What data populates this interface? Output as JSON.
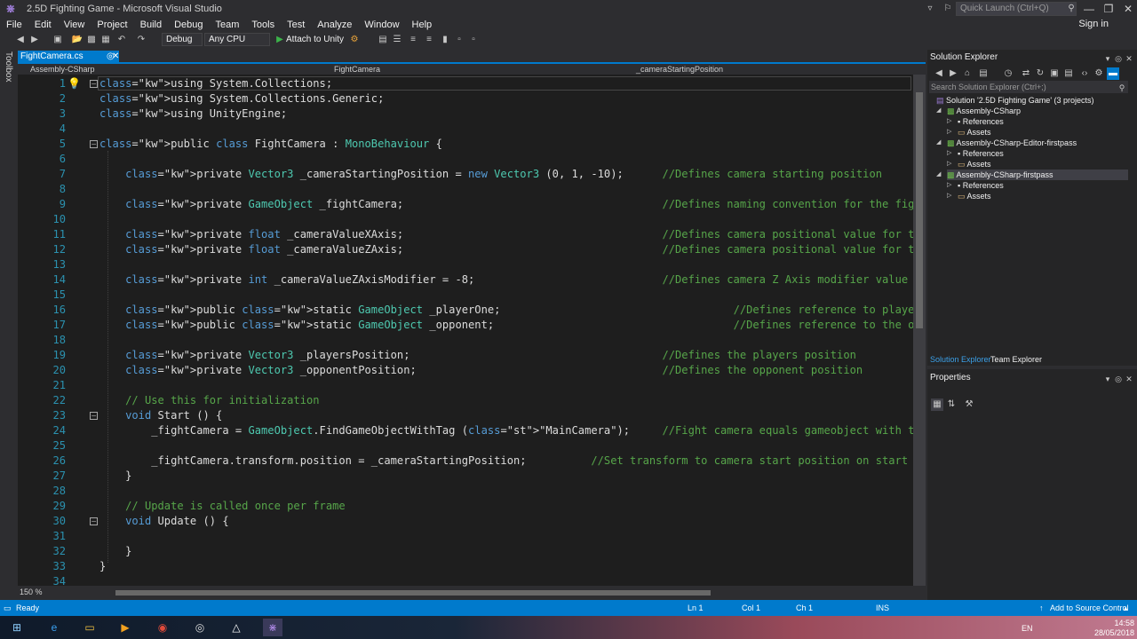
{
  "window": {
    "title": "2.5D Fighting Game - Microsoft Visual Studio",
    "quick_launch_placeholder": "Quick Launch (Ctrl+Q)",
    "sign_in": "Sign in",
    "minimize": "—",
    "restore": "❐",
    "close": "✕"
  },
  "menu": [
    "File",
    "Edit",
    "View",
    "Project",
    "Build",
    "Debug",
    "Team",
    "Tools",
    "Test",
    "Analyze",
    "Window",
    "Help"
  ],
  "toolbar": {
    "config": "Debug",
    "platform": "Any CPU",
    "attach": "Attach to Unity"
  },
  "toolbox_label": "Toolbox",
  "editor": {
    "tab": "FightCamera.cs",
    "nav_project": "Assembly-CSharp",
    "nav_class": "FightCamera",
    "nav_member": "_cameraStartingPosition",
    "zoom": "150 %",
    "lines": [
      {
        "n": "1",
        "t": "using System.Collections;"
      },
      {
        "n": "2",
        "t": "using System.Collections.Generic;"
      },
      {
        "n": "3",
        "t": "using UnityEngine;"
      },
      {
        "n": "4",
        "t": ""
      },
      {
        "n": "5",
        "t": "public class FightCamera : MonoBehaviour {"
      },
      {
        "n": "6",
        "t": ""
      },
      {
        "n": "7",
        "t": "    private Vector3 _cameraStartingPosition = new Vector3 (0, 1, -10);      //Defines camera starting position"
      },
      {
        "n": "8",
        "t": ""
      },
      {
        "n": "9",
        "t": "    private GameObject _fightCamera;                                        //Defines naming convention for the fight camera gam"
      },
      {
        "n": "10",
        "t": ""
      },
      {
        "n": "11",
        "t": "    private float _cameraValueXAxis;                                        //Defines camera positional value for the X Axis"
      },
      {
        "n": "12",
        "t": "    private float _cameraValueZAxis;                                        //Defines camera positional value for the Z Axis"
      },
      {
        "n": "13",
        "t": ""
      },
      {
        "n": "14",
        "t": "    private int _cameraValueZAxisModifier = -8;                             //Defines camera Z Axis modifier value"
      },
      {
        "n": "15",
        "t": ""
      },
      {
        "n": "16",
        "t": "    public static GameObject _playerOne;                                    //Defines reference to player ones gameobject"
      },
      {
        "n": "17",
        "t": "    public static GameObject _opponent;                                     //Defines reference to the opponents gameobject"
      },
      {
        "n": "18",
        "t": ""
      },
      {
        "n": "19",
        "t": "    private Vector3 _playersPosition;                                       //Defines the players position"
      },
      {
        "n": "20",
        "t": "    private Vector3 _opponentPosition;                                      //Defines the opponent position"
      },
      {
        "n": "21",
        "t": ""
      },
      {
        "n": "22",
        "t": "    // Use this for initialization"
      },
      {
        "n": "23",
        "t": "    void Start () {"
      },
      {
        "n": "24",
        "t": "        _fightCamera = GameObject.FindGameObjectWithTag (\"MainCamera\");     //Fight camera equals gameobject with the tag of \"Ma"
      },
      {
        "n": "25",
        "t": ""
      },
      {
        "n": "26",
        "t": "        _fightCamera.transform.position = _cameraStartingPosition;          //Set transform to camera start position on start up"
      },
      {
        "n": "27",
        "t": "    }"
      },
      {
        "n": "28",
        "t": ""
      },
      {
        "n": "29",
        "t": "    // Update is called once per frame"
      },
      {
        "n": "30",
        "t": "    void Update () {"
      },
      {
        "n": "31",
        "t": ""
      },
      {
        "n": "32",
        "t": "    }"
      },
      {
        "n": "33",
        "t": "}"
      },
      {
        "n": "34",
        "t": ""
      }
    ]
  },
  "solution_explorer": {
    "title": "Solution Explorer",
    "search_placeholder": "Search Solution Explorer (Ctrl+;)",
    "items": [
      "Solution '2.5D Fighting Game' (3 projects)",
      "Assembly-CSharp",
      "References",
      "Assets",
      "Assembly-CSharp-Editor-firstpass",
      "References",
      "Assets",
      "Assembly-CSharp-firstpass",
      "References",
      "Assets"
    ],
    "tab_solution": "Solution Explorer",
    "tab_team": "Team Explorer"
  },
  "properties": {
    "title": "Properties"
  },
  "status": {
    "ready": "Ready",
    "ln": "Ln 1",
    "col": "Col 1",
    "ch": "Ch 1",
    "ins": "INS",
    "source_control": "Add to Source Control"
  },
  "taskbar": {
    "lang": "EN",
    "time": "14:58",
    "date": "28/05/2018"
  },
  "colors": {
    "accent": "#007acc",
    "keyword": "#569cd6",
    "type": "#4ec9b0",
    "comment": "#57a64a",
    "string": "#d69d85"
  }
}
